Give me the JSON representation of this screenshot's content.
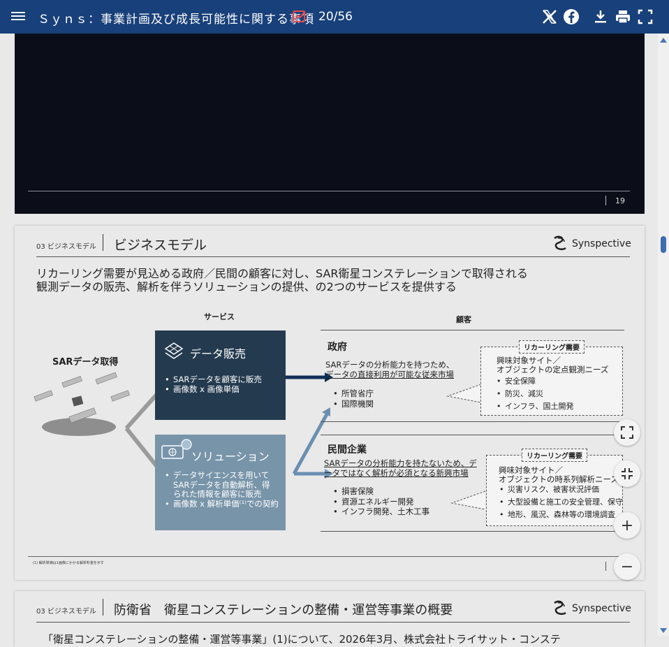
{
  "topbar": {
    "title": "Ｓｙｎｓ：事業計画及び成長可能性に関する事項",
    "page_indicator": "20/56",
    "accent": "#18407a"
  },
  "slide19": {
    "page_number": "19"
  },
  "slide20": {
    "section_label": "03 ビジネスモデル",
    "title": "ビジネスモデル",
    "logo_text": "Synspective",
    "lead_line1": "リカーリング需要が見込める政府／民間の顧客に対し、SAR衛星コンステレーションで取得される",
    "lead_line2": "観測データの販売、解析を伴うソリューションの提供、の2つのサービスを提供する",
    "service_header": "サービス",
    "customer_header": "顧客",
    "sar_label": "SARデータ取得",
    "data_sales": {
      "title": "データ販売",
      "items": [
        "SARデータを顧客に販売",
        "画像数 x 画像単価"
      ]
    },
    "solution": {
      "title": "ソリューション",
      "item1_line1": "データサイエンスを用いて",
      "item1_line2": "SARデータを自動解析、得",
      "item1_line3": "られた情報を顧客に販売",
      "item2": "画像数 x 解析単価⁽¹⁾での契約"
    },
    "government": {
      "title": "政府",
      "desc_line1": "SARデータの分析能力を持つため、",
      "desc_line2": "データの直接利用が可能な従来市場",
      "items": [
        "所管省庁",
        "国際機関"
      ],
      "bubble_tag": "リカーリング需要",
      "bubble_sub1": "興味対象サイト／",
      "bubble_sub2": "オブジェクトの定点観測ニーズ",
      "needs": [
        "安全保障",
        "防災、減災",
        "インフラ、国土開発"
      ]
    },
    "private": {
      "title": "民間企業",
      "desc_line1": "SARデータの分析能力を持たないため、デ",
      "desc_line2": "ータではなく解析が必須となる新興市場",
      "items": [
        "損害保険",
        "資源エネルギー開発",
        "インフラ開発、土木工事"
      ],
      "bubble_tag": "リカーリング需要",
      "bubble_sub1": "興味対象サイト／",
      "bubble_sub2": "オブジェクトの時系列解析ニーズ",
      "needs": [
        "災害リスク、被害状況評価",
        "大型設備と施工の安全管理、保守",
        "地形、風況、森林等の環境調査"
      ]
    },
    "footnote": "(1) 解析単価は1画像にかかる解析料金を示す"
  },
  "slide21": {
    "section_label": "03 ビジネスモデル",
    "title": "防衛省　衛星コンステレーションの整備・運営等事業の概要",
    "logo_text": "Synspective",
    "cut_text": "「衛星コンステレーションの整備・運営等事業」(1)について、2026年3月、株式会社トライサット・コンステ"
  },
  "controls": {
    "fullscreen_label": "⛶",
    "exit_fullscreen_label": "⤡",
    "zoom_in_label": "+",
    "zoom_out_label": "−"
  }
}
